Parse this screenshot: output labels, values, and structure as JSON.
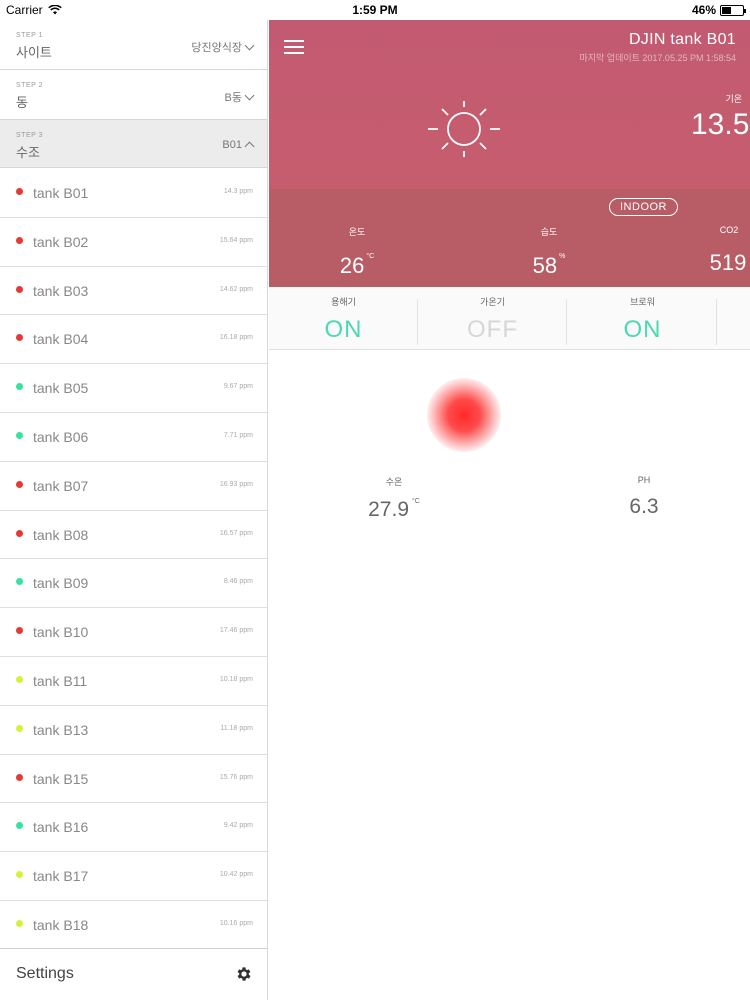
{
  "status_bar": {
    "carrier": "Carrier",
    "time": "1:59 PM",
    "battery": "46%",
    "battery_level": 0.46
  },
  "sidebar": {
    "steps": [
      {
        "num": "STEP 1",
        "label": "사이트",
        "value": "당진양식장"
      },
      {
        "num": "STEP 2",
        "label": "동",
        "value": "B동"
      },
      {
        "num": "STEP 3",
        "label": "수조",
        "value": "B01"
      }
    ],
    "tanks": [
      {
        "name": "tank B01",
        "ppm": "14.3 ppm",
        "color": "#e53935"
      },
      {
        "name": "tank B02",
        "ppm": "15.64 ppm",
        "color": "#e53935"
      },
      {
        "name": "tank B03",
        "ppm": "14.62 ppm",
        "color": "#e53935"
      },
      {
        "name": "tank B04",
        "ppm": "16.18 ppm",
        "color": "#e53935"
      },
      {
        "name": "tank B05",
        "ppm": "9.67 ppm",
        "color": "#35e3a0"
      },
      {
        "name": "tank B06",
        "ppm": "7.71 ppm",
        "color": "#35e3a0"
      },
      {
        "name": "tank B07",
        "ppm": "16.93 ppm",
        "color": "#e53935"
      },
      {
        "name": "tank B08",
        "ppm": "16.57 ppm",
        "color": "#e53935"
      },
      {
        "name": "tank B09",
        "ppm": "8.46 ppm",
        "color": "#35e3a0"
      },
      {
        "name": "tank B10",
        "ppm": "17.46 ppm",
        "color": "#e53935"
      },
      {
        "name": "tank B11",
        "ppm": "10.18 ppm",
        "color": "#d8f03a"
      },
      {
        "name": "tank B13",
        "ppm": "11.18 ppm",
        "color": "#d8f03a"
      },
      {
        "name": "tank B15",
        "ppm": "15.76 ppm",
        "color": "#e53935"
      },
      {
        "name": "tank B16",
        "ppm": "9.42 ppm",
        "color": "#35e3a0"
      },
      {
        "name": "tank B17",
        "ppm": "10.42 ppm",
        "color": "#d8f03a"
      },
      {
        "name": "tank B18",
        "ppm": "10.16 ppm",
        "color": "#d8f03a"
      }
    ],
    "settings_label": "Settings"
  },
  "main": {
    "title": "DJIN tank B01",
    "subtitle": "마지막 업데이트 2017.05.25 PM 1:58:54",
    "outdoor_label": "기온",
    "outdoor_value": "13.5",
    "indoor_badge": "INDOOR",
    "metrics": [
      {
        "label": "온도",
        "value": "26",
        "unit": "°C"
      },
      {
        "label": "습도",
        "value": "58",
        "unit": "%"
      },
      {
        "label": "CO2",
        "value": "519",
        "unit": ""
      }
    ],
    "toggles": [
      {
        "label": "용해기",
        "value": "ON",
        "color": "#4dd9b0"
      },
      {
        "label": "가온기",
        "value": "OFF",
        "color": "#d6d6d6"
      },
      {
        "label": "브로워",
        "value": "ON",
        "color": "#4dd9b0"
      }
    ],
    "readings": [
      {
        "label": "수온",
        "value": "27.9",
        "unit": "°C"
      },
      {
        "label": "PH",
        "value": "6.3",
        "unit": ""
      }
    ],
    "status_color": "#ff2a2a",
    "hero_color": "#c25a72"
  }
}
